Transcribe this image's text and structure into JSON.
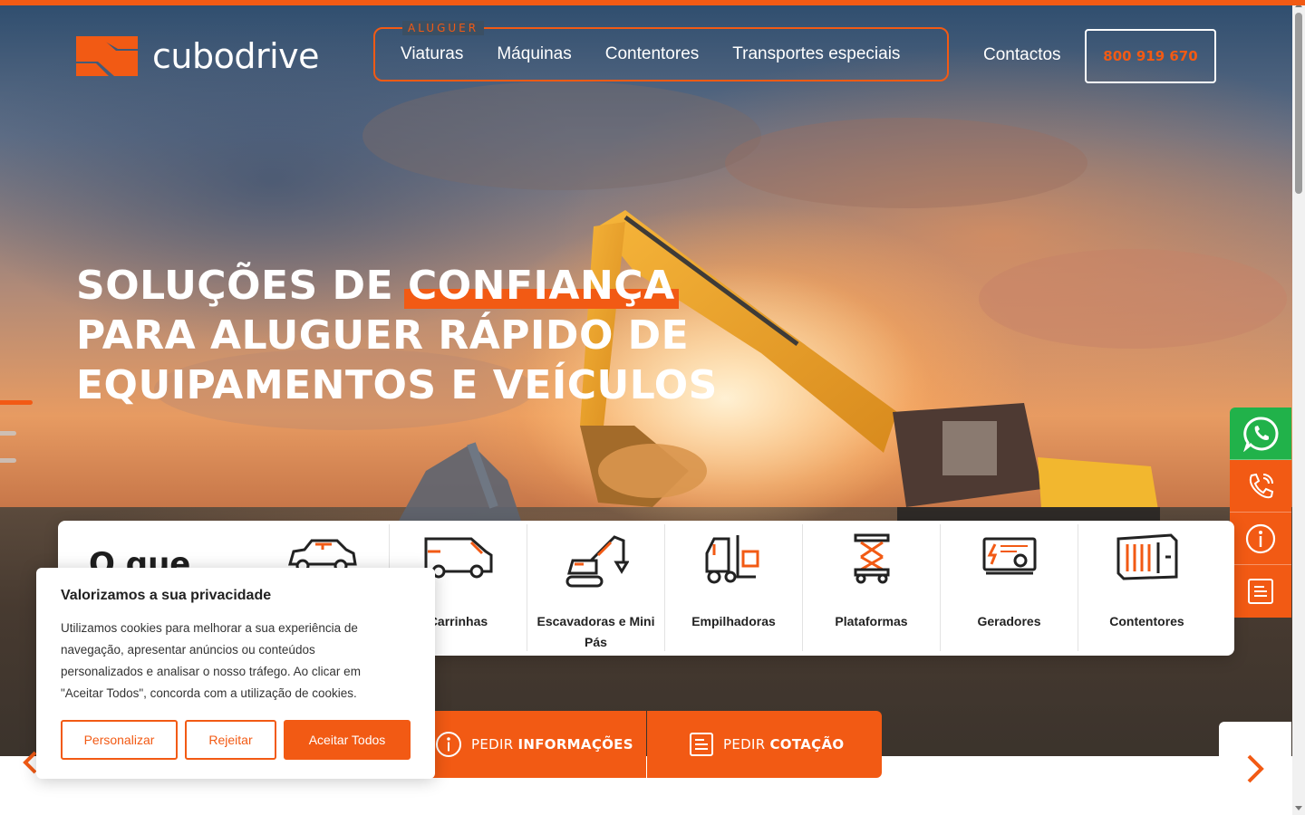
{
  "brand": {
    "name": "cubodrive",
    "accent": "#f25a14",
    "whatsapp_color": "#21b24a"
  },
  "nav": {
    "group_label": "ALUGUER",
    "items": [
      "Viaturas",
      "Máquinas",
      "Contentores",
      "Transportes especiais"
    ],
    "contacts": "Contactos",
    "phone": "800 919 670"
  },
  "hero": {
    "line1_pre": "SOLUÇÕES DE ",
    "line1_highlight": "CONFIANÇA",
    "line2": "PARA ALUGUER RÁPIDO DE",
    "line3": "EQUIPAMENTOS E VEÍCULOS"
  },
  "floating_actions": [
    {
      "icon": "whatsapp-icon"
    },
    {
      "icon": "phone-icon"
    },
    {
      "icon": "info-icon"
    },
    {
      "icon": "document-icon"
    }
  ],
  "categories": {
    "heading": "O que",
    "items": [
      {
        "label": "",
        "icon": "car-icon"
      },
      {
        "label": "Carrinhas",
        "icon": "van-icon"
      },
      {
        "label": "Escavadoras e Mini Pás",
        "icon": "excavator-icon"
      },
      {
        "label": "Empilhadoras",
        "icon": "forklift-icon"
      },
      {
        "label": "Plataformas",
        "icon": "scissor-lift-icon"
      },
      {
        "label": "Geradores",
        "icon": "generator-icon"
      },
      {
        "label": "Contentores",
        "icon": "container-icon"
      }
    ]
  },
  "cta": {
    "info_pre": "PEDIR ",
    "info_bold": "INFORMAÇÕES",
    "quote_pre": "PEDIR ",
    "quote_bold": "COTAÇÃO"
  },
  "cookie": {
    "title": "Valorizamos a sua privacidade",
    "text": "Utilizamos cookies para melhorar a sua experiência de navegação, apresentar anúncios ou conteúdos personalizados e analisar o nosso tráfego. Ao clicar em \"Aceitar Todos\", concorda com a utilização de cookies.",
    "customize": "Personalizar",
    "reject": "Rejeitar",
    "accept": "Aceitar Todos"
  }
}
